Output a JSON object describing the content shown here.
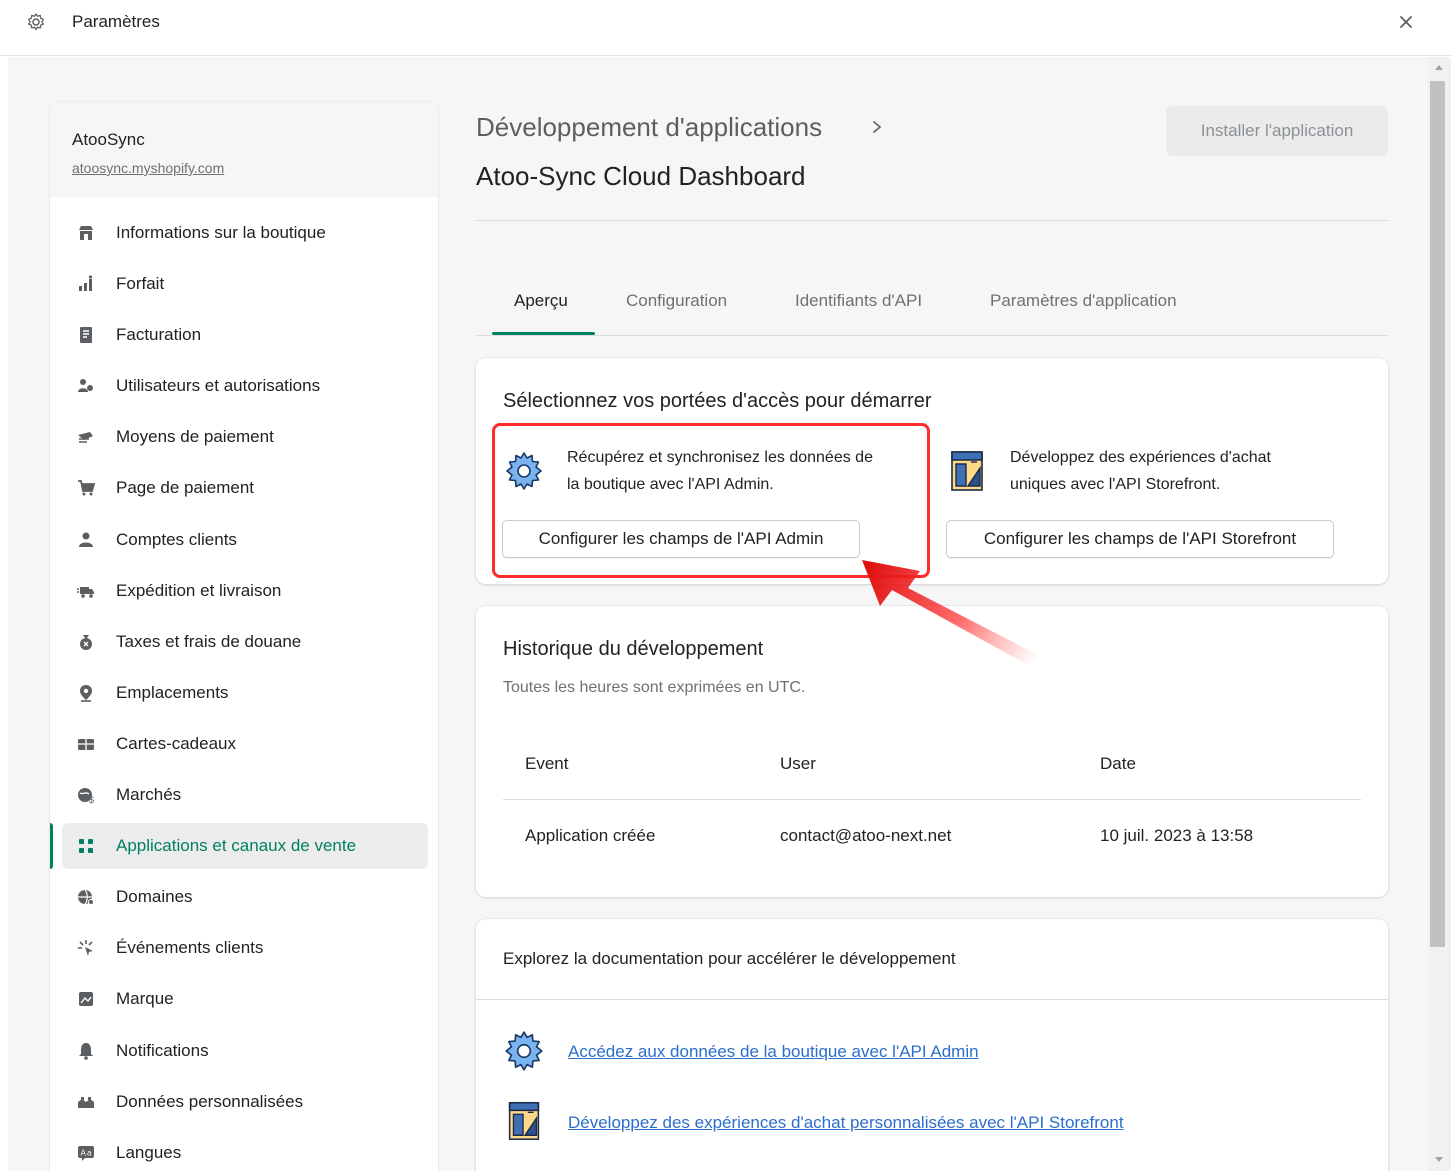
{
  "window": {
    "title": "Paramètres",
    "icon": "gear-icon",
    "close_icon": "close-icon"
  },
  "sidebar": {
    "store_name": "AtooSync",
    "store_url": "atoosync.myshopify.com",
    "items": [
      {
        "label": "Informations sur la boutique",
        "icon": "store-icon"
      },
      {
        "label": "Forfait",
        "icon": "plan-icon"
      },
      {
        "label": "Facturation",
        "icon": "billing-icon"
      },
      {
        "label": "Utilisateurs et autorisations",
        "icon": "users-icon"
      },
      {
        "label": "Moyens de paiement",
        "icon": "payment-icon"
      },
      {
        "label": "Page de paiement",
        "icon": "checkout-icon"
      },
      {
        "label": "Comptes clients",
        "icon": "customer-icon"
      },
      {
        "label": "Expédition et livraison",
        "icon": "shipping-icon"
      },
      {
        "label": "Taxes et frais de douane",
        "icon": "taxes-icon"
      },
      {
        "label": "Emplacements",
        "icon": "location-icon"
      },
      {
        "label": "Cartes-cadeaux",
        "icon": "gift-card-icon"
      },
      {
        "label": "Marchés",
        "icon": "markets-icon"
      },
      {
        "label": "Applications et canaux de vente",
        "icon": "apps-icon",
        "active": true
      },
      {
        "label": "Domaines",
        "icon": "domains-icon"
      },
      {
        "label": "Événements clients",
        "icon": "events-icon"
      },
      {
        "label": "Marque",
        "icon": "brand-icon"
      },
      {
        "label": "Notifications",
        "icon": "notification-icon"
      },
      {
        "label": "Données personnalisées",
        "icon": "custom-data-icon"
      },
      {
        "label": "Langues",
        "icon": "languages-icon"
      }
    ]
  },
  "header": {
    "breadcrumb": "Développement d'applications",
    "title": "Atoo-Sync Cloud Dashboard",
    "install_button": "Installer l'application"
  },
  "tabs": [
    {
      "label": "Aperçu",
      "active": true
    },
    {
      "label": "Configuration"
    },
    {
      "label": "Identifiants d'API"
    },
    {
      "label": "Paramètres d'application"
    }
  ],
  "scopes": {
    "title": "Sélectionnez vos portées d'accès pour démarrer",
    "admin": {
      "text_line1": "Récupérez et synchronisez les données de",
      "text_line2": "la boutique avec l'API Admin.",
      "button": "Configurer les champs de l'API Admin",
      "icon": "admin-api-gear-icon"
    },
    "storefront": {
      "text_line1": "Développez des expériences d'achat",
      "text_line2": "uniques avec l'API Storefront.",
      "button": "Configurer les champs de l'API Storefront",
      "icon": "storefront-api-icon"
    },
    "highlight_color": "#ff2a2a"
  },
  "history": {
    "title": "Historique du développement",
    "subtitle": "Toutes les heures sont exprimées en UTC.",
    "columns": [
      "Event",
      "User",
      "Date"
    ],
    "rows": [
      [
        "Application créée",
        "contact@atoo-next.net",
        "10 juil. 2023 à 13:58"
      ]
    ]
  },
  "docs": {
    "heading": "Explorez la documentation pour accélérer le développement",
    "links": [
      {
        "label": "Accédez aux données de la boutique avec l'API Admin",
        "icon": "admin-api-gear-icon"
      },
      {
        "label": "Développez des expériences d'achat personnalisées avec l'API Storefront",
        "icon": "storefront-api-icon"
      }
    ]
  },
  "colors": {
    "accent": "#008060",
    "link": "#2c6ecb",
    "annotation": "#ff2a2a"
  }
}
